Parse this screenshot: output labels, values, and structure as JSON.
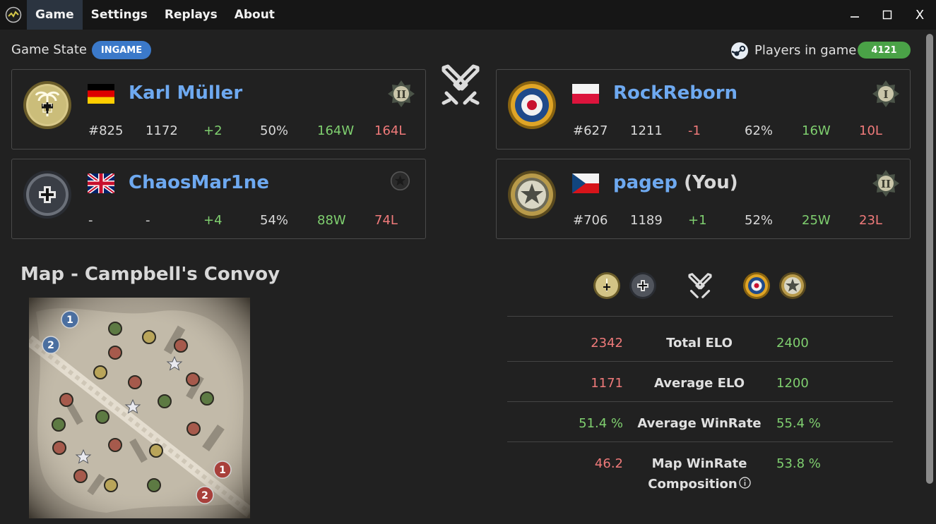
{
  "titlebar": {
    "tabs": [
      "Game",
      "Settings",
      "Replays",
      "About"
    ],
    "active_tab": "Game",
    "controls": {
      "minimize": "—",
      "maximize": "☐",
      "close": "X"
    }
  },
  "header": {
    "game_state_label": "Game State",
    "game_state_value": "INGAME",
    "players_label": "Players in game",
    "players_count": "4121"
  },
  "team_left": [
    {
      "name": "Karl Müller",
      "you_suffix": "",
      "flag": "germany-flag",
      "faction": "afrika-korps-emblem",
      "rank_icon": "rank-2-icon",
      "rank": "#825",
      "elo": "1172",
      "change": "+2",
      "winrate": "50%",
      "wins": "164W",
      "losses": "164L"
    },
    {
      "name": "ChaosMar1ne",
      "you_suffix": "",
      "flag": "uk-flag",
      "faction": "wehrmacht-emblem",
      "rank_icon": "unranked-icon",
      "rank": "-",
      "elo": "-",
      "change": "+4",
      "winrate": "54%",
      "wins": "88W",
      "losses": "74L"
    }
  ],
  "team_right": [
    {
      "name": "RockReborn",
      "you_suffix": "",
      "flag": "poland-flag",
      "faction": "british-emblem",
      "rank_icon": "rank-1-icon",
      "rank": "#627",
      "elo": "1211",
      "change": "-1",
      "winrate": "62%",
      "wins": "16W",
      "losses": "10L"
    },
    {
      "name": "pagep",
      "you_suffix": " (You)",
      "flag": "czech-flag",
      "faction": "us-emblem",
      "rank_icon": "rank-2-icon",
      "rank": "#706",
      "elo": "1189",
      "change": "+1",
      "winrate": "52%",
      "wins": "25W",
      "losses": "23L"
    }
  ],
  "map": {
    "title": "Map - Campbell's Convoy",
    "markers_blue": [
      "1",
      "2"
    ],
    "markers_red": [
      "1",
      "2"
    ]
  },
  "comparison": {
    "rows": [
      {
        "label": "Total ELO",
        "left": "2342",
        "right": "2400"
      },
      {
        "label": "Average ELO",
        "left": "1171",
        "right": "1200"
      },
      {
        "label": "Average WinRate",
        "left": "51.4 %",
        "right": "55.4 %"
      },
      {
        "label_line1": "Map WinRate",
        "label_line2": "Composition",
        "left": "46.2",
        "right": "53.8 %"
      }
    ]
  },
  "colors": {
    "accent_blue": "#6ea9f0",
    "positive": "#7fcf6f",
    "negative": "#ef7a7a",
    "ingame_badge": "#3b79c9",
    "count_badge": "#4aa247"
  }
}
